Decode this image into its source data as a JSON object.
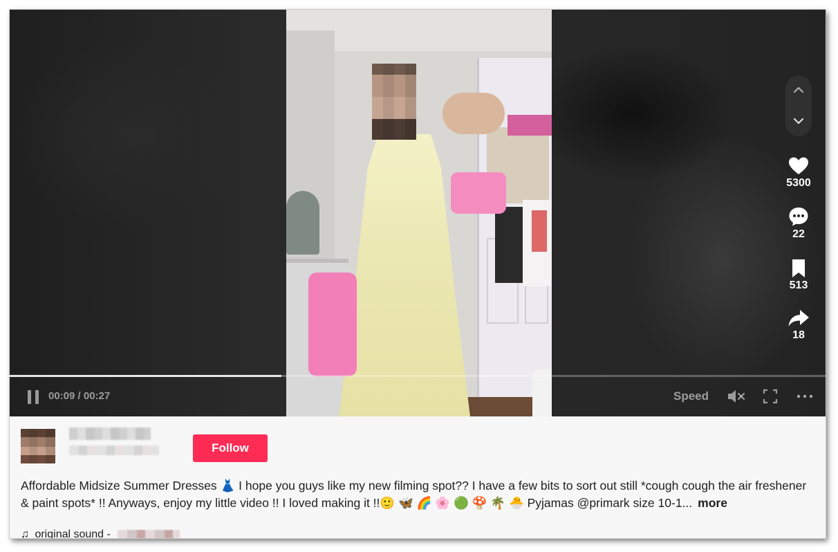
{
  "player": {
    "current_time": "00:09",
    "duration": "00:27",
    "time_display": "00:09 / 00:27",
    "progress_fraction": 0.333,
    "speed_label": "Speed"
  },
  "actions": {
    "likes": "5300",
    "comments": "22",
    "saves": "513",
    "shares": "18"
  },
  "post": {
    "follow_label": "Follow",
    "caption": "Affordable Midsize Summer Dresses 👗 I hope you guys like my new filming spot?? I have a few bits to sort out still *cough cough the air freshener & paint spots* !! Anyways, enjoy my little video !! I loved making it !!🙂 🦋 🌈 🌸 🟢 🍄 🌴 🐣 Pyjamas @primark size 10-1...",
    "more_label": "more",
    "sound_label": "original sound -"
  },
  "icons": {
    "music": "♫"
  },
  "colors": {
    "follow_button": "#fe2c55",
    "video_bg": "#1e1e1e"
  }
}
